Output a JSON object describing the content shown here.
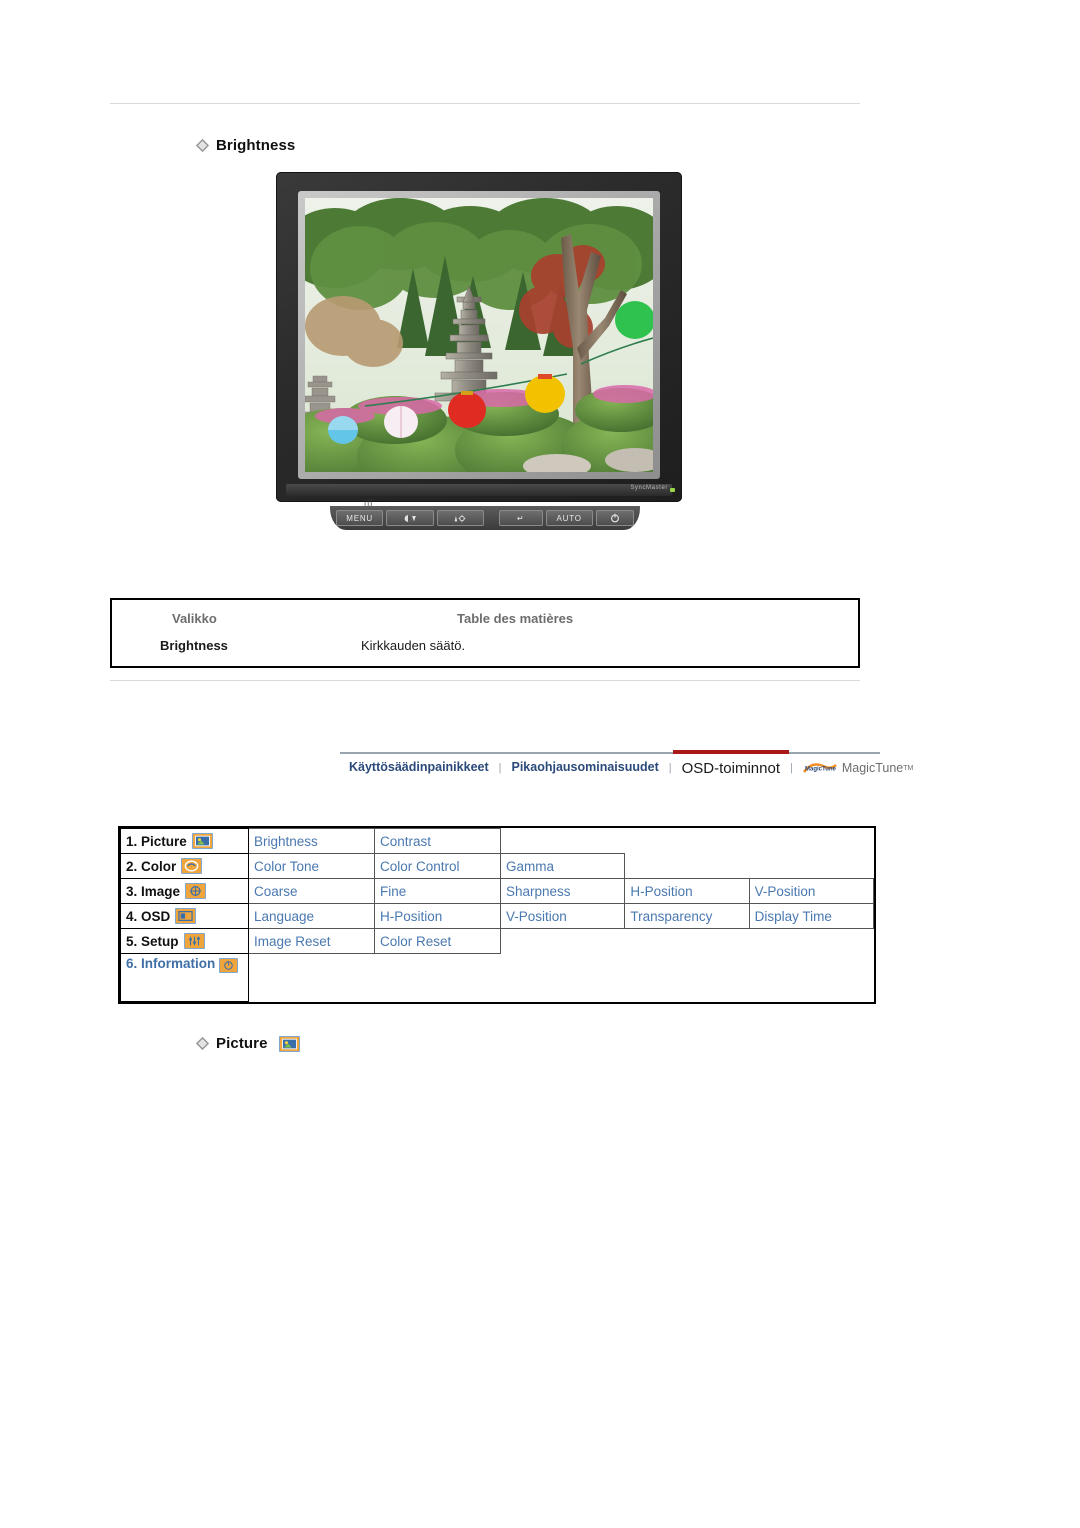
{
  "page": {
    "brightness_heading": "Brightness",
    "picture_heading": "Picture",
    "bullet_icon": "diamond-bullet-icon"
  },
  "monitor": {
    "screen_description": "garden-photo-with-pagoda-and-lanterns",
    "logo_text": "SyncMaster",
    "buttons": [
      {
        "name": "menu-button",
        "label": "MENU"
      },
      {
        "name": "brightness-down-button",
        "label": "/ ▼"
      },
      {
        "name": "up-adjust-button",
        "label": "▲ /"
      },
      {
        "name": "enter-button",
        "label": "↵"
      },
      {
        "name": "auto-button",
        "label": "AUTO"
      },
      {
        "name": "power-button",
        "label": "⏻"
      }
    ]
  },
  "desc_table": {
    "header_menu": "Valikko",
    "header_toc": "Table des matières",
    "rows": [
      {
        "menu": "Brightness",
        "description": "Kirkkauden säätö."
      }
    ]
  },
  "tabs": [
    {
      "label": "Käyttösäädinpainikkeet",
      "active": false
    },
    {
      "label": "Pikaohjausominaisuudet",
      "active": false
    },
    {
      "label": "OSD-toiminnot",
      "active": true
    },
    {
      "label": "MagicTune",
      "active": false,
      "trademark": "TM"
    }
  ],
  "tab_separator": "|",
  "osd_menu": {
    "rows": [
      {
        "category": "1. Picture",
        "icon": "picture-icon",
        "items": [
          "Brightness",
          "Contrast"
        ]
      },
      {
        "category": "2. Color",
        "icon": "color-icon",
        "items": [
          "Color Tone",
          "Color Control",
          "Gamma"
        ]
      },
      {
        "category": "3. Image",
        "icon": "image-icon",
        "items": [
          "Coarse",
          "Fine",
          "Sharpness",
          "H-Position",
          "V-Position"
        ]
      },
      {
        "category": "4. OSD",
        "icon": "osd-icon",
        "items": [
          "Language",
          "H-Position",
          "V-Position",
          "Transparency",
          "Display Time"
        ]
      },
      {
        "category": "5. Setup",
        "icon": "setup-icon",
        "items": [
          "Image Reset",
          "Color Reset"
        ]
      },
      {
        "category": "6. Information",
        "icon": "information-icon",
        "items": []
      }
    ]
  },
  "colors": {
    "link_blue": "#4a78b0",
    "tab_blue": "#2b4a7a",
    "active_tab_underline": "#a81818",
    "icon_orange": "#f0a53c",
    "icon_border_blue": "#7fa8d0",
    "header_gray": "#6d6d6d",
    "rule_gray": "#d9d9d9"
  }
}
